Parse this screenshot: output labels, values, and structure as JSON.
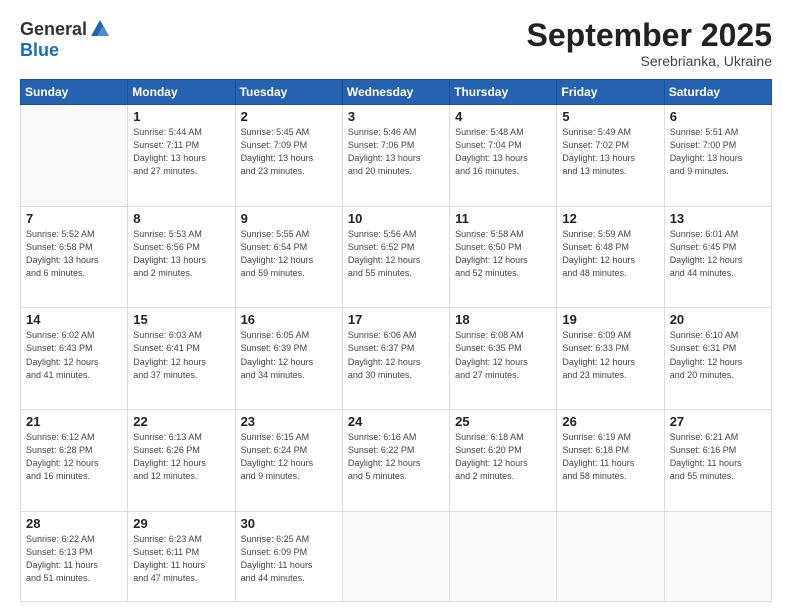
{
  "header": {
    "logo_general": "General",
    "logo_blue": "Blue",
    "month": "September 2025",
    "location": "Serebrianka, Ukraine"
  },
  "weekdays": [
    "Sunday",
    "Monday",
    "Tuesday",
    "Wednesday",
    "Thursday",
    "Friday",
    "Saturday"
  ],
  "weeks": [
    [
      {
        "day": "",
        "info": ""
      },
      {
        "day": "1",
        "info": "Sunrise: 5:44 AM\nSunset: 7:11 PM\nDaylight: 13 hours\nand 27 minutes."
      },
      {
        "day": "2",
        "info": "Sunrise: 5:45 AM\nSunset: 7:09 PM\nDaylight: 13 hours\nand 23 minutes."
      },
      {
        "day": "3",
        "info": "Sunrise: 5:46 AM\nSunset: 7:06 PM\nDaylight: 13 hours\nand 20 minutes."
      },
      {
        "day": "4",
        "info": "Sunrise: 5:48 AM\nSunset: 7:04 PM\nDaylight: 13 hours\nand 16 minutes."
      },
      {
        "day": "5",
        "info": "Sunrise: 5:49 AM\nSunset: 7:02 PM\nDaylight: 13 hours\nand 13 minutes."
      },
      {
        "day": "6",
        "info": "Sunrise: 5:51 AM\nSunset: 7:00 PM\nDaylight: 13 hours\nand 9 minutes."
      }
    ],
    [
      {
        "day": "7",
        "info": "Sunrise: 5:52 AM\nSunset: 6:58 PM\nDaylight: 13 hours\nand 6 minutes."
      },
      {
        "day": "8",
        "info": "Sunrise: 5:53 AM\nSunset: 6:56 PM\nDaylight: 13 hours\nand 2 minutes."
      },
      {
        "day": "9",
        "info": "Sunrise: 5:55 AM\nSunset: 6:54 PM\nDaylight: 12 hours\nand 59 minutes."
      },
      {
        "day": "10",
        "info": "Sunrise: 5:56 AM\nSunset: 6:52 PM\nDaylight: 12 hours\nand 55 minutes."
      },
      {
        "day": "11",
        "info": "Sunrise: 5:58 AM\nSunset: 6:50 PM\nDaylight: 12 hours\nand 52 minutes."
      },
      {
        "day": "12",
        "info": "Sunrise: 5:59 AM\nSunset: 6:48 PM\nDaylight: 12 hours\nand 48 minutes."
      },
      {
        "day": "13",
        "info": "Sunrise: 6:01 AM\nSunset: 6:45 PM\nDaylight: 12 hours\nand 44 minutes."
      }
    ],
    [
      {
        "day": "14",
        "info": "Sunrise: 6:02 AM\nSunset: 6:43 PM\nDaylight: 12 hours\nand 41 minutes."
      },
      {
        "day": "15",
        "info": "Sunrise: 6:03 AM\nSunset: 6:41 PM\nDaylight: 12 hours\nand 37 minutes."
      },
      {
        "day": "16",
        "info": "Sunrise: 6:05 AM\nSunset: 6:39 PM\nDaylight: 12 hours\nand 34 minutes."
      },
      {
        "day": "17",
        "info": "Sunrise: 6:06 AM\nSunset: 6:37 PM\nDaylight: 12 hours\nand 30 minutes."
      },
      {
        "day": "18",
        "info": "Sunrise: 6:08 AM\nSunset: 6:35 PM\nDaylight: 12 hours\nand 27 minutes."
      },
      {
        "day": "19",
        "info": "Sunrise: 6:09 AM\nSunset: 6:33 PM\nDaylight: 12 hours\nand 23 minutes."
      },
      {
        "day": "20",
        "info": "Sunrise: 6:10 AM\nSunset: 6:31 PM\nDaylight: 12 hours\nand 20 minutes."
      }
    ],
    [
      {
        "day": "21",
        "info": "Sunrise: 6:12 AM\nSunset: 6:28 PM\nDaylight: 12 hours\nand 16 minutes."
      },
      {
        "day": "22",
        "info": "Sunrise: 6:13 AM\nSunset: 6:26 PM\nDaylight: 12 hours\nand 12 minutes."
      },
      {
        "day": "23",
        "info": "Sunrise: 6:15 AM\nSunset: 6:24 PM\nDaylight: 12 hours\nand 9 minutes."
      },
      {
        "day": "24",
        "info": "Sunrise: 6:16 AM\nSunset: 6:22 PM\nDaylight: 12 hours\nand 5 minutes."
      },
      {
        "day": "25",
        "info": "Sunrise: 6:18 AM\nSunset: 6:20 PM\nDaylight: 12 hours\nand 2 minutes."
      },
      {
        "day": "26",
        "info": "Sunrise: 6:19 AM\nSunset: 6:18 PM\nDaylight: 11 hours\nand 58 minutes."
      },
      {
        "day": "27",
        "info": "Sunrise: 6:21 AM\nSunset: 6:16 PM\nDaylight: 11 hours\nand 55 minutes."
      }
    ],
    [
      {
        "day": "28",
        "info": "Sunrise: 6:22 AM\nSunset: 6:13 PM\nDaylight: 11 hours\nand 51 minutes."
      },
      {
        "day": "29",
        "info": "Sunrise: 6:23 AM\nSunset: 6:11 PM\nDaylight: 11 hours\nand 47 minutes."
      },
      {
        "day": "30",
        "info": "Sunrise: 6:25 AM\nSunset: 6:09 PM\nDaylight: 11 hours\nand 44 minutes."
      },
      {
        "day": "",
        "info": ""
      },
      {
        "day": "",
        "info": ""
      },
      {
        "day": "",
        "info": ""
      },
      {
        "day": "",
        "info": ""
      }
    ]
  ]
}
